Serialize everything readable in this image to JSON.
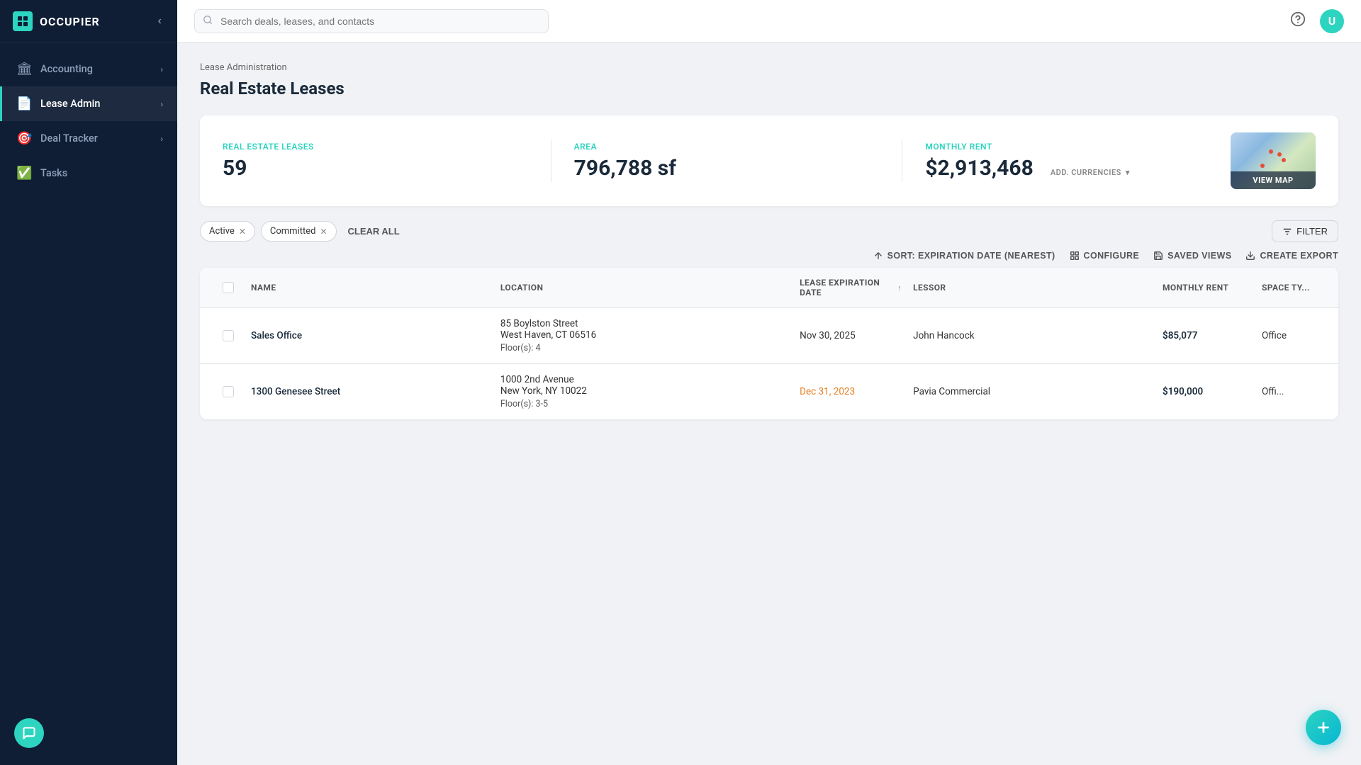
{
  "sidebar": {
    "logo_text": "OCCUPIER",
    "logo_initial": "O",
    "items": [
      {
        "id": "accounting",
        "label": "Accounting",
        "icon": "🏛",
        "has_chevron": true,
        "active": false
      },
      {
        "id": "lease-admin",
        "label": "Lease Admin",
        "icon": "📄",
        "has_chevron": true,
        "active": true
      },
      {
        "id": "deal-tracker",
        "label": "Deal Tracker",
        "icon": "🎯",
        "has_chevron": true,
        "active": false
      },
      {
        "id": "tasks",
        "label": "Tasks",
        "icon": "✅",
        "has_chevron": false,
        "active": false
      }
    ]
  },
  "topbar": {
    "search_placeholder": "Search deals, leases, and contacts"
  },
  "page": {
    "breadcrumb": "Lease Administration",
    "title": "Real Estate Leases"
  },
  "stats": {
    "leases_label": "Real Estate Leases",
    "leases_value": "59",
    "area_label": "Area",
    "area_value": "796,788 sf",
    "rent_label": "Monthly Rent",
    "rent_value": "$2,913,468",
    "add_currencies_label": "ADD. CURRENCIES",
    "view_map_label": "VIEW MAP"
  },
  "filters": {
    "active_label": "Active",
    "committed_label": "Committed",
    "clear_all_label": "CLEAR ALL",
    "filter_label": "FILTER"
  },
  "toolbar": {
    "sort_label": "SORT: EXPIRATION DATE (NEAREST)",
    "configure_label": "CONFIGURE",
    "saved_views_label": "SAVED VIEWS",
    "create_export_label": "CREATE EXPORT"
  },
  "table": {
    "columns": [
      "Name",
      "Location",
      "Lease Expiration Date",
      "Lessor",
      "Monthly Rent",
      "Space Ty..."
    ],
    "rows": [
      {
        "name": "Sales Office",
        "location_line1": "85 Boylston Street",
        "location_line2": "West Haven, CT 06516",
        "floor": "Floor(s): 4",
        "exp_date": "Nov 30, 2025",
        "exp_overdue": false,
        "lessor": "John Hancock",
        "rent": "$85,077",
        "space_type": "Office"
      },
      {
        "name": "1300 Genesee Street",
        "location_line1": "1000 2nd Avenue",
        "location_line2": "New York, NY 10022",
        "floor": "Floor(s): 3-5",
        "exp_date": "Dec 31, 2023",
        "exp_overdue": true,
        "lessor": "Pavia Commercial",
        "rent": "$190,000",
        "space_type": "Offi..."
      }
    ]
  }
}
